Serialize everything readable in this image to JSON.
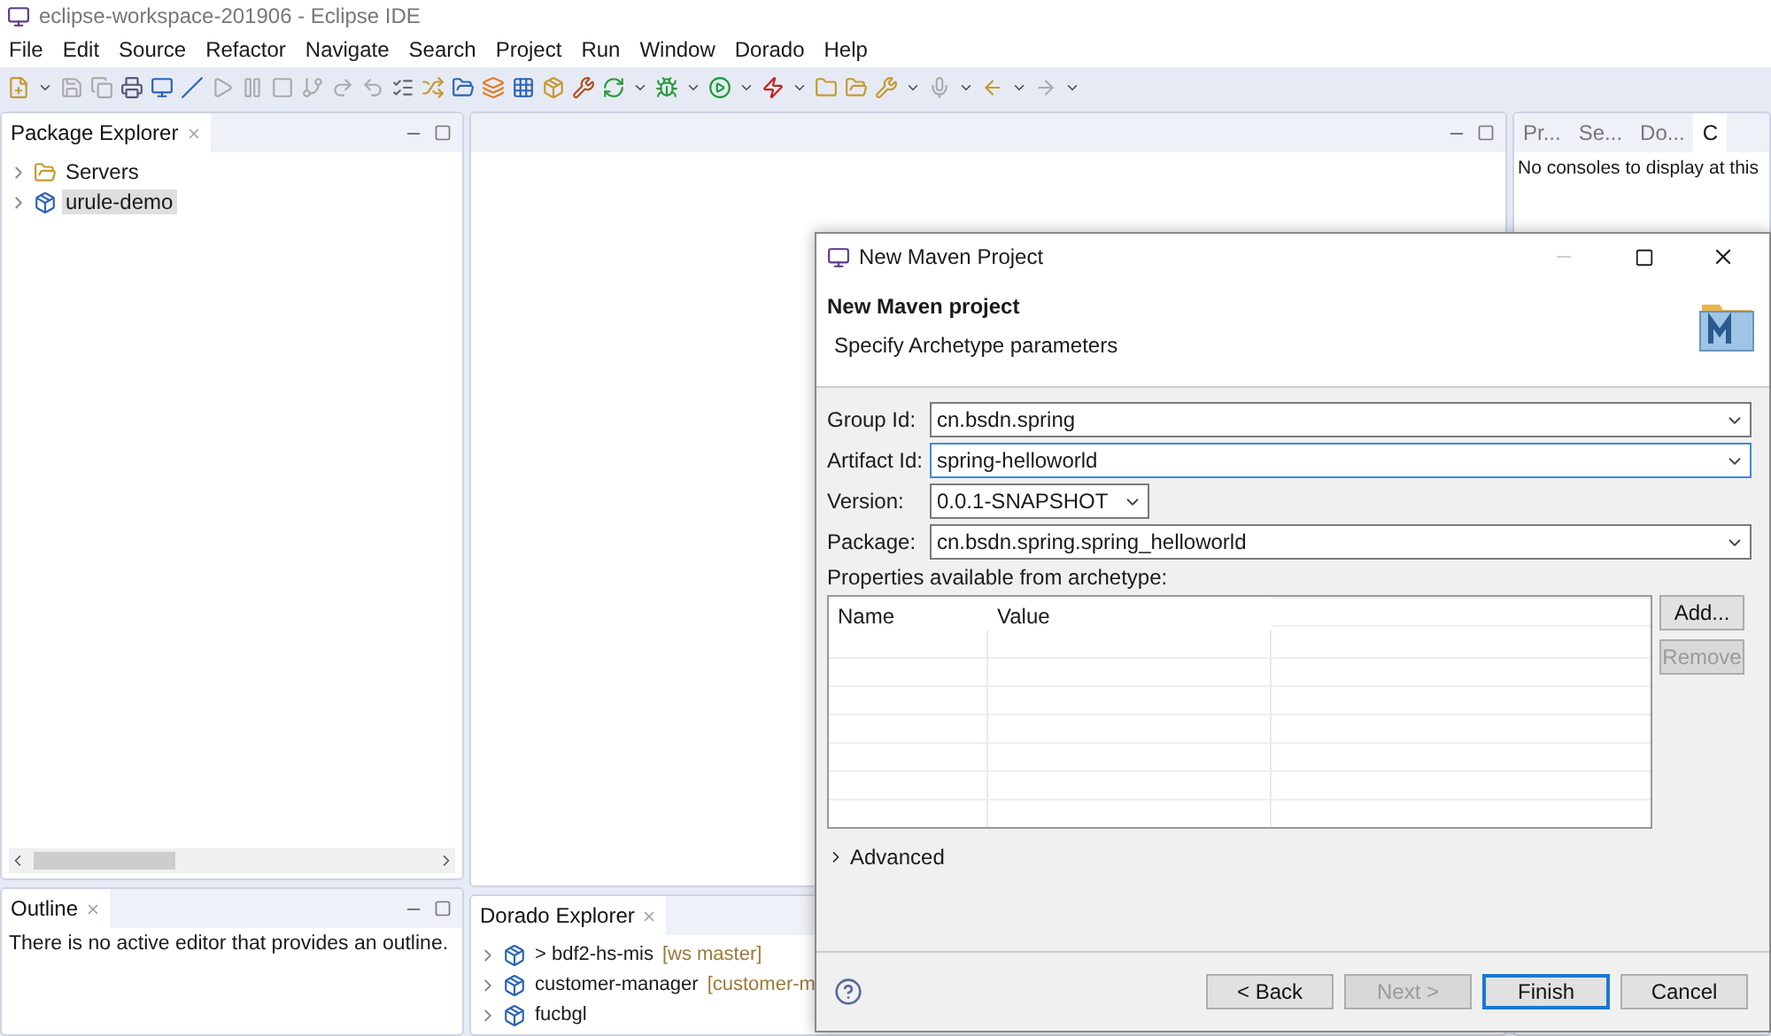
{
  "window": {
    "title": "eclipse-workspace-201906 - Eclipse IDE"
  },
  "menu": [
    "File",
    "Edit",
    "Source",
    "Refactor",
    "Navigate",
    "Search",
    "Project",
    "Run",
    "Window",
    "Dorado",
    "Help"
  ],
  "package_explorer": {
    "title": "Package Explorer",
    "items": [
      {
        "label": "Servers",
        "kind": "folder",
        "selected": false
      },
      {
        "label": "urule-demo",
        "kind": "project",
        "selected": true
      }
    ]
  },
  "outline": {
    "title": "Outline",
    "message": "There is no active editor that provides an outline."
  },
  "dorado_explorer": {
    "title": "Dorado Explorer",
    "items": [
      {
        "label": "> bdf2-hs-mis",
        "tag": "[ws master]"
      },
      {
        "label": "customer-manager",
        "tag": "[customer-m"
      },
      {
        "label": "fucbgl"
      }
    ]
  },
  "console_panel": {
    "tabs": [
      {
        "label": "Pr...",
        "selected": false
      },
      {
        "label": "Se...",
        "selected": false
      },
      {
        "label": "Do...",
        "selected": false
      },
      {
        "label": "C",
        "selected": true
      }
    ],
    "message": "No consoles to display at this"
  },
  "dialog": {
    "title": "New Maven Project",
    "heading": "New Maven project",
    "subheading": "Specify Archetype parameters",
    "fields": [
      {
        "label": "Group Id:",
        "value": "cn.bsdn.spring",
        "focused": false,
        "wide": true
      },
      {
        "label": "Artifact Id:",
        "value": "spring-helloworld",
        "focused": true,
        "wide": true
      },
      {
        "label": "Version:",
        "value": "0.0.1-SNAPSHOT",
        "focused": false,
        "wide": false
      },
      {
        "label": "Package:",
        "value": "cn.bsdn.spring.spring_helloworld",
        "focused": false,
        "wide": true
      }
    ],
    "properties_label": "Properties available from archetype:",
    "columns": [
      "Name",
      "Value"
    ],
    "side_buttons": [
      {
        "label": "Add...",
        "disabled": false
      },
      {
        "label": "Remove",
        "disabled": true
      }
    ],
    "advanced": {
      "label": "Advanced",
      "expanded": false
    },
    "buttons": [
      {
        "label": "< Back",
        "disabled": false,
        "default": false
      },
      {
        "label": "Next >",
        "disabled": true,
        "default": false
      },
      {
        "label": "Finish",
        "disabled": false,
        "default": true
      },
      {
        "label": "Cancel",
        "disabled": false,
        "default": false
      }
    ]
  }
}
